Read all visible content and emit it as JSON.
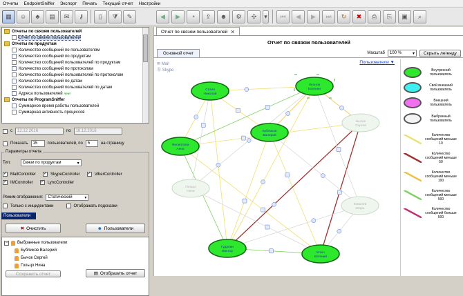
{
  "menu": [
    "Отчеты",
    "EndpointSniffer",
    "Экспорт",
    "Печать",
    "Текущий отчет",
    "Настройки"
  ],
  "tree": {
    "groups": [
      {
        "label": "Отчеты по связям пользователей",
        "items": [
          "Отчет по связям пользователей"
        ]
      },
      {
        "label": "Отчеты по продуктам",
        "items": [
          "Количество сообщений по пользователям",
          "Количество сообщений по продуктам",
          "Количество сообщений пользователей по продуктам",
          "Количество сообщений по протоколам",
          "Количество сообщений пользователей по протоколам",
          "Количество сообщений по датам",
          "Количество сообщений пользователей по датам",
          "Адреса пользователей"
        ]
      },
      {
        "label": "Отчеты по ProgramSniffer",
        "items": [
          "Суммарное время работы пользователей",
          "Суммарная активность процессов"
        ]
      }
    ],
    "new_tag": "new!"
  },
  "date_filter": {
    "label_c": "с",
    "from": "12.12.2016",
    "label_po": "по",
    "to": "18.12.2016"
  },
  "show_row": {
    "label": "Показать",
    "count": "15",
    "mid": "пользователей, по",
    "per_page": "5",
    "suffix": "на страницу"
  },
  "params": {
    "title": "Параметры отчета",
    "type_label": "Тип:",
    "type_value": "Связи по продуктам",
    "controllers": [
      "MailController",
      "SkypeController",
      "ViberController",
      "IMController",
      "LyncController"
    ],
    "mode_label": "Режим отображения:",
    "mode_value": "Статический",
    "only_incidents": "Только с инцидентами",
    "show_hints": "Отображать подсказки"
  },
  "users_panel": {
    "header": "Пользователи",
    "clear_btn": "Очистить",
    "users_btn": "Пользователи",
    "root": "Выбранные пользователи",
    "list": [
      "Бубликов Валерий",
      "Бычок Сергей",
      "Гольцо Нина"
    ],
    "bottom_left": "Сохранить отчет",
    "bottom_right": "Отобразить отчет"
  },
  "doc_tab": "Отчет по связям пользователей",
  "report_title": "Отчет по связям пользователей",
  "sub_tab": "Основной отчет",
  "scale_label": "Масштаб",
  "scale_value": "100 %",
  "hide_legend": "Скрыть легенду",
  "users_dropdown": "Пользователи ▼",
  "channels": [
    "Mail",
    "Skype"
  ],
  "nodes": [
    {
      "name": "Сатин\nНиколай",
      "state": "normal"
    },
    {
      "name": "Леонов\nЕвгения",
      "state": "selected"
    },
    {
      "name": "Бубликов\nВалерий",
      "state": "normal"
    },
    {
      "name": "Филиппова\nАнна",
      "state": "normal"
    },
    {
      "name": "Гудалин\nВиктор",
      "state": "normal"
    },
    {
      "name": "Ключ\nЕвгений",
      "state": "normal"
    },
    {
      "name": "Гольцо\nНина",
      "state": "faded"
    },
    {
      "name": "Бычок\nСергей",
      "state": "faded"
    },
    {
      "name": "Ковалев\nИгорь",
      "state": "faded"
    }
  ],
  "legend": [
    {
      "label": "Внутренний пользователь",
      "fill": "#2ee82e"
    },
    {
      "label": "Свой внешний пользователь",
      "fill": "#40f0f0"
    },
    {
      "label": "Внешний пользователь",
      "fill": "#f070f0"
    },
    {
      "label": "Выбранный пользователь",
      "fill": "#f4f4f4"
    },
    {
      "label": "Количество сообщений меньше 10",
      "color": "#f0e070"
    },
    {
      "label": "Количество сообщений меньше 50",
      "color": "#a03030"
    },
    {
      "label": "Количество сообщений меньше 100",
      "color": "#f0c040"
    },
    {
      "label": "Количество сообщений меньше 500",
      "color": "#80d060"
    },
    {
      "label": "Количество сообщений больше 500",
      "color": "#c03070"
    }
  ]
}
